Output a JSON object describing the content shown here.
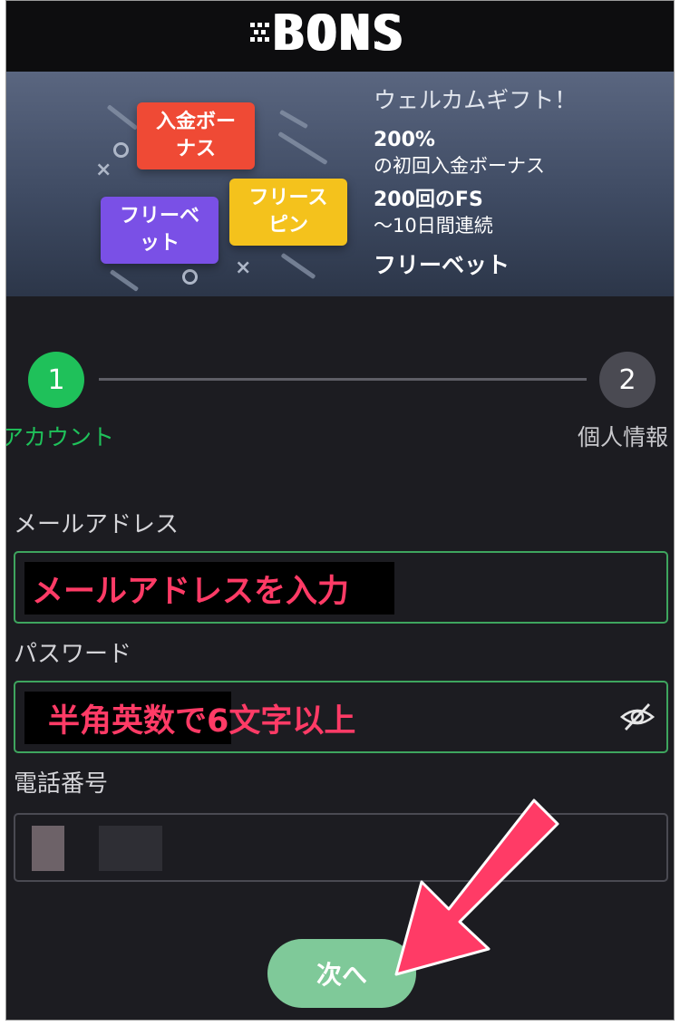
{
  "header": {
    "logo": "BONS"
  },
  "banner": {
    "cards": [
      "入金ボーナス",
      "フリーベット",
      "フリースピン"
    ],
    "title": "ウェルカムギフト！",
    "line1_big": "200%",
    "line1_sub": "の初回入金ボーナス",
    "line2_big": "200回のFS",
    "line2_sub": "〜10日間連続",
    "line3": "フリーベット"
  },
  "stepper": {
    "steps": [
      {
        "number": "1",
        "label": "アカウント"
      },
      {
        "number": "2",
        "label": "個人情報"
      }
    ]
  },
  "form": {
    "email_label": "メールアドレス",
    "email_annotation": "メールアドレスを入力",
    "password_label": "パスワード",
    "password_annotation": "半角英数で6文字以上",
    "phone_label": "電話番号",
    "next_button": "次へ"
  },
  "colors": {
    "accent": "#1fc15a",
    "annotation": "#ff3b66",
    "button": "#7fc999",
    "background": "#1c1c21"
  }
}
